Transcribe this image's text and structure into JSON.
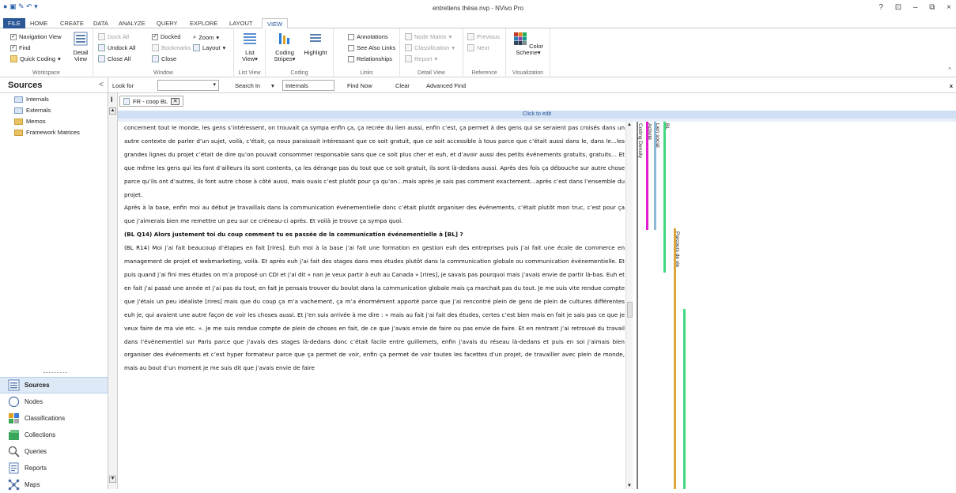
{
  "app": {
    "title": "entretiens thèse.nvp - NVivo Pro",
    "window_controls": [
      "?",
      "⊡",
      "–",
      "⧉",
      "×"
    ]
  },
  "ribbon_tabs": [
    {
      "label": "FILE"
    },
    {
      "label": "HOME"
    },
    {
      "label": "CREATE"
    },
    {
      "label": "DATA"
    },
    {
      "label": "ANALYZE"
    },
    {
      "label": "QUERY"
    },
    {
      "label": "EXPLORE"
    },
    {
      "label": "LAYOUT"
    },
    {
      "label": "VIEW"
    }
  ],
  "ribbon": {
    "workspace": {
      "label": "Workspace",
      "navigation_view": "Navigation View",
      "find": "Find",
      "quick_coding": "Quick Coding",
      "detail_view": "Detail View"
    },
    "window": {
      "label": "Window",
      "dock_all": "Dock All",
      "undock_all": "Undock All",
      "close_all": "Close All",
      "docked": "Docked",
      "bookmarks": "Bookmarks",
      "close": "Close",
      "zoom": "Zoom",
      "layout": "Layout"
    },
    "list_view": {
      "label": "List View",
      "button": "List View"
    },
    "coding": {
      "label": "Coding",
      "coding_stripes": "Coding Stripes",
      "highlight": "Highlight"
    },
    "links": {
      "label": "Links",
      "annotations": "Annotations",
      "see_also_links": "See Also Links",
      "relationships": "Relationships"
    },
    "detail_view": {
      "label": "Detail View",
      "node_matrix": "Node Matrix",
      "classification": "Classification",
      "report": "Report"
    },
    "reference": {
      "label": "Reference",
      "previous": "Previous",
      "next": "Next"
    },
    "visualization": {
      "label": "Visualization",
      "color_scheme": "Color Scheme"
    }
  },
  "findbar": {
    "look_for": "Look for",
    "look_for_value": "",
    "search_in": "Search In",
    "search_in_value": "Internals",
    "find_now": "Find Now",
    "clear": "Clear",
    "advanced_find": "Advanced Find",
    "close": "x"
  },
  "nav": {
    "title": "Sources",
    "tree": [
      "Internals",
      "Externals",
      "Memos",
      "Framework Matrices"
    ],
    "buttons": [
      "Sources",
      "Nodes",
      "Classifications",
      "Collections",
      "Queries",
      "Reports",
      "Maps"
    ]
  },
  "document": {
    "tab_label": "FR - coop BL",
    "click_to_edit": "Click to edit",
    "paragraphs": [
      {
        "bold": false,
        "text": "concernent tout le monde, les gens s’intéressent, on trouvait ça sympa enfin ça, ça recrée du lien aussi, enfin c’est, ça permet à des gens qui se seraient pas croisés dans un autre contexte de parler d’un sujet, voilà, c’était, ça nous paraissait intéressant que ce soit gratuit, que ce soit accessible à tous parce que c’était aussi dans le, dans le...les grandes lignes du projet c’était de dire qu’on pouvait consommer responsable sans que ce soit plus cher et euh, et d’avoir aussi des petits événements gratuits, gratuits… Et que même les gens qui les font d’ailleurs ils sont contents, ça les dérange pas du tout que ce soit gratuit, ils sont là-dedans aussi. Après des fois ça débouche sur autre chose parce qu’ils ont d’autres, ils font autre chose à côté aussi, mais ouais c’est plutôt pour ça qu’on…mais après je sais pas comment exactement…après c’est dans l’ensemble du projet."
      },
      {
        "bold": false,
        "text": "Après à la base, enfin moi au début je travaillais dans la communication événementielle donc c’était plutôt organiser des événements, c’était plutôt mon truc, c’est pour ça que j’aimerais bien me remettre un peu sur ce créneau-ci après. Et voilà je trouve ça sympa quoi."
      },
      {
        "bold": false,
        "text": " "
      },
      {
        "bold": true,
        "text": "(BL Q14) Alors justement toi du coup comment tu es passée de la communication événementielle à [BL] ?"
      },
      {
        "bold": false,
        "text": " "
      },
      {
        "bold": false,
        "text": "(BL R14) Moi j’ai fait beaucoup d’étapes en fait [rires]. Euh moi à la base j’ai fait une formation en gestion euh des entreprises puis j’ai fait une école de commerce en management de projet et webmarketing, voilà. Et après euh j’ai fait des stages dans mes études plutôt dans la communication globale ou communication événementielle. Et puis quand j’ai fini mes études on m’a proposé un CDI et j’ai dit « nan je veux partir à euh au Canada » [rires], je savais pas pourquoi mais j’avais envie de partir là-bas. Euh et en fait j’ai passé une année et j’ai pas du tout, en fait je pensais trouver du boulot dans la communication globale mais ça marchait pas du tout. Je me suis vite rendue compte que j’étais un peu idéaliste [rires] mais que du coup ça m’a vachement, ça m’a énormément apporté parce que j’ai rencontré plein de gens de plein de cultures différentes euh je, qui avaient une autre façon de voir les choses aussi. Et j’en suis arrivée à me dire : « mais au fait j’ai fait des études, certes c’est bien mais en fait je sais pas ce que je veux faire de ma vie etc. ». Je me suis rendue compte de plein de choses en fait, de ce que j’avais envie de faire ou pas envie de faire. Et en rentrant j’ai retrouvé du travail dans l’événementiel sur Paris parce que j’avais des stages là-dedans donc c’était facile entre guillemets, enfin j’avais du réseau là-dedans et puis en soi j’aimais bien organiser des événements et c’est hyper formateur parce que ça permet de voir, enfin ça permet de voir toutes les facettes d’un projet, de travailler avec plein de monde, mais au bout d’un moment je me suis dit que j’avais envie de faire"
      }
    ]
  },
  "coding_stripes": [
    {
      "label": "Coding Density",
      "color": "#7a7a7a",
      "start": 0,
      "end": 1
    },
    {
      "label": "Activité",
      "color": "#e020d0",
      "start": 0.0,
      "end": 0.295
    },
    {
      "label": "Lien social",
      "color": "#8fb8d6",
      "start": 0.0,
      "end": 0.295
    },
    {
      "label": "BL",
      "color": "#40d880",
      "start": 0.0,
      "end": 0.41
    },
    {
      "label": "Parcours de vie",
      "color": "#d9a73a",
      "start": 0.29,
      "end": 1.0
    },
    {
      "label": "",
      "color": "#40d880",
      "start": 0.51,
      "end": 1.0
    }
  ]
}
